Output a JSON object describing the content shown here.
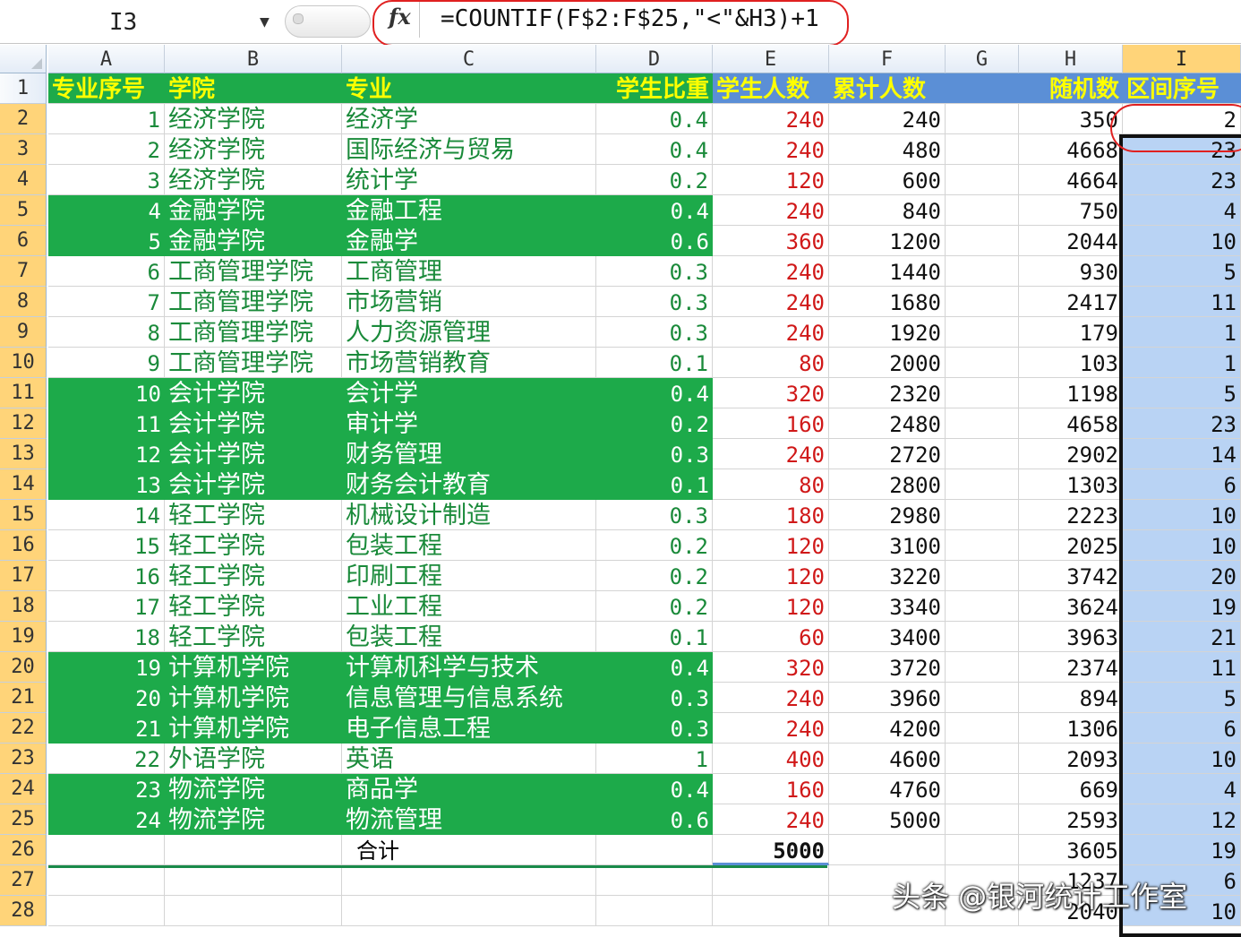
{
  "formula_bar": {
    "name_box": "I3",
    "formula": "=COUNTIF(F$2:F$25,\"<\"&H3)+1",
    "fx_label": "fx"
  },
  "colors": {
    "header_green": "#1daa4a",
    "header_text_yellow": "#ffff00",
    "text_green": "#1a8a3a",
    "text_red": "#d01818",
    "header_blue": "#5b8fd6",
    "selection_blue": "#b9d3f4",
    "selected_header": "#ffd479"
  },
  "columns": [
    "A",
    "B",
    "C",
    "D",
    "E",
    "F",
    "G",
    "H",
    "I"
  ],
  "selected_column": "I",
  "row_numbers": [
    "1",
    "2",
    "3",
    "4",
    "5",
    "6",
    "7",
    "8",
    "9",
    "10",
    "11",
    "12",
    "13",
    "14",
    "15",
    "16",
    "17",
    "18",
    "19",
    "20",
    "21",
    "22",
    "23",
    "24",
    "25",
    "26",
    "27",
    "28"
  ],
  "headers": {
    "A": "专业序号",
    "B": "学院",
    "C": "专业",
    "D": "学生比重",
    "E": "学生人数",
    "F": "累计人数",
    "G": "",
    "H": "随机数",
    "I": "区间序号"
  },
  "rows": [
    {
      "a": "1",
      "b": "经济学院",
      "c": "经济学",
      "d": "0.4",
      "e": "240",
      "f": "240",
      "h": "350",
      "i": "2",
      "green": false
    },
    {
      "a": "2",
      "b": "经济学院",
      "c": "国际经济与贸易",
      "d": "0.4",
      "e": "240",
      "f": "480",
      "h": "4668",
      "i": "23",
      "green": false
    },
    {
      "a": "3",
      "b": "经济学院",
      "c": "统计学",
      "d": "0.2",
      "e": "120",
      "f": "600",
      "h": "4664",
      "i": "23",
      "green": false
    },
    {
      "a": "4",
      "b": "金融学院",
      "c": "金融工程",
      "d": "0.4",
      "e": "240",
      "f": "840",
      "h": "750",
      "i": "4",
      "green": true
    },
    {
      "a": "5",
      "b": "金融学院",
      "c": "金融学",
      "d": "0.6",
      "e": "360",
      "f": "1200",
      "h": "2044",
      "i": "10",
      "green": true
    },
    {
      "a": "6",
      "b": "工商管理学院",
      "c": "工商管理",
      "d": "0.3",
      "e": "240",
      "f": "1440",
      "h": "930",
      "i": "5",
      "green": false
    },
    {
      "a": "7",
      "b": "工商管理学院",
      "c": "市场营销",
      "d": "0.3",
      "e": "240",
      "f": "1680",
      "h": "2417",
      "i": "11",
      "green": false
    },
    {
      "a": "8",
      "b": "工商管理学院",
      "c": "人力资源管理",
      "d": "0.3",
      "e": "240",
      "f": "1920",
      "h": "179",
      "i": "1",
      "green": false
    },
    {
      "a": "9",
      "b": "工商管理学院",
      "c": "市场营销教育",
      "d": "0.1",
      "e": "80",
      "f": "2000",
      "h": "103",
      "i": "1",
      "green": false
    },
    {
      "a": "10",
      "b": "会计学院",
      "c": "会计学",
      "d": "0.4",
      "e": "320",
      "f": "2320",
      "h": "1198",
      "i": "5",
      "green": true
    },
    {
      "a": "11",
      "b": "会计学院",
      "c": "审计学",
      "d": "0.2",
      "e": "160",
      "f": "2480",
      "h": "4658",
      "i": "23",
      "green": true
    },
    {
      "a": "12",
      "b": "会计学院",
      "c": "财务管理",
      "d": "0.3",
      "e": "240",
      "f": "2720",
      "h": "2902",
      "i": "14",
      "green": true
    },
    {
      "a": "13",
      "b": "会计学院",
      "c": "财务会计教育",
      "d": "0.1",
      "e": "80",
      "f": "2800",
      "h": "1303",
      "i": "6",
      "green": true
    },
    {
      "a": "14",
      "b": "轻工学院",
      "c": "机械设计制造",
      "d": "0.3",
      "e": "180",
      "f": "2980",
      "h": "2223",
      "i": "10",
      "green": false
    },
    {
      "a": "15",
      "b": "轻工学院",
      "c": "包装工程",
      "d": "0.2",
      "e": "120",
      "f": "3100",
      "h": "2025",
      "i": "10",
      "green": false
    },
    {
      "a": "16",
      "b": "轻工学院",
      "c": "印刷工程",
      "d": "0.2",
      "e": "120",
      "f": "3220",
      "h": "3742",
      "i": "20",
      "green": false
    },
    {
      "a": "17",
      "b": "轻工学院",
      "c": "工业工程",
      "d": "0.2",
      "e": "120",
      "f": "3340",
      "h": "3624",
      "i": "19",
      "green": false
    },
    {
      "a": "18",
      "b": "轻工学院",
      "c": "包装工程",
      "d": "0.1",
      "e": "60",
      "f": "3400",
      "h": "3963",
      "i": "21",
      "green": false
    },
    {
      "a": "19",
      "b": "计算机学院",
      "c": "计算机科学与技术",
      "d": "0.4",
      "e": "320",
      "f": "3720",
      "h": "2374",
      "i": "11",
      "green": true
    },
    {
      "a": "20",
      "b": "计算机学院",
      "c": "信息管理与信息系统",
      "d": "0.3",
      "e": "240",
      "f": "3960",
      "h": "894",
      "i": "5",
      "green": true
    },
    {
      "a": "21",
      "b": "计算机学院",
      "c": "电子信息工程",
      "d": "0.3",
      "e": "240",
      "f": "4200",
      "h": "1306",
      "i": "6",
      "green": true
    },
    {
      "a": "22",
      "b": "外语学院",
      "c": "英语",
      "d": "1",
      "e": "400",
      "f": "4600",
      "h": "2093",
      "i": "10",
      "green": false
    },
    {
      "a": "23",
      "b": "物流学院",
      "c": "商品学",
      "d": "0.4",
      "e": "160",
      "f": "4760",
      "h": "669",
      "i": "4",
      "green": true
    },
    {
      "a": "24",
      "b": "物流学院",
      "c": "物流管理",
      "d": "0.6",
      "e": "240",
      "f": "5000",
      "h": "2593",
      "i": "12",
      "green": true
    }
  ],
  "total_row": {
    "label": "合计",
    "e": "5000",
    "h": "3605",
    "i": "19"
  },
  "extra_rows": [
    {
      "h": "1237",
      "i": "6"
    },
    {
      "h": "2040",
      "i": "10"
    }
  ],
  "watermark": "头条 @银河统计工作室"
}
